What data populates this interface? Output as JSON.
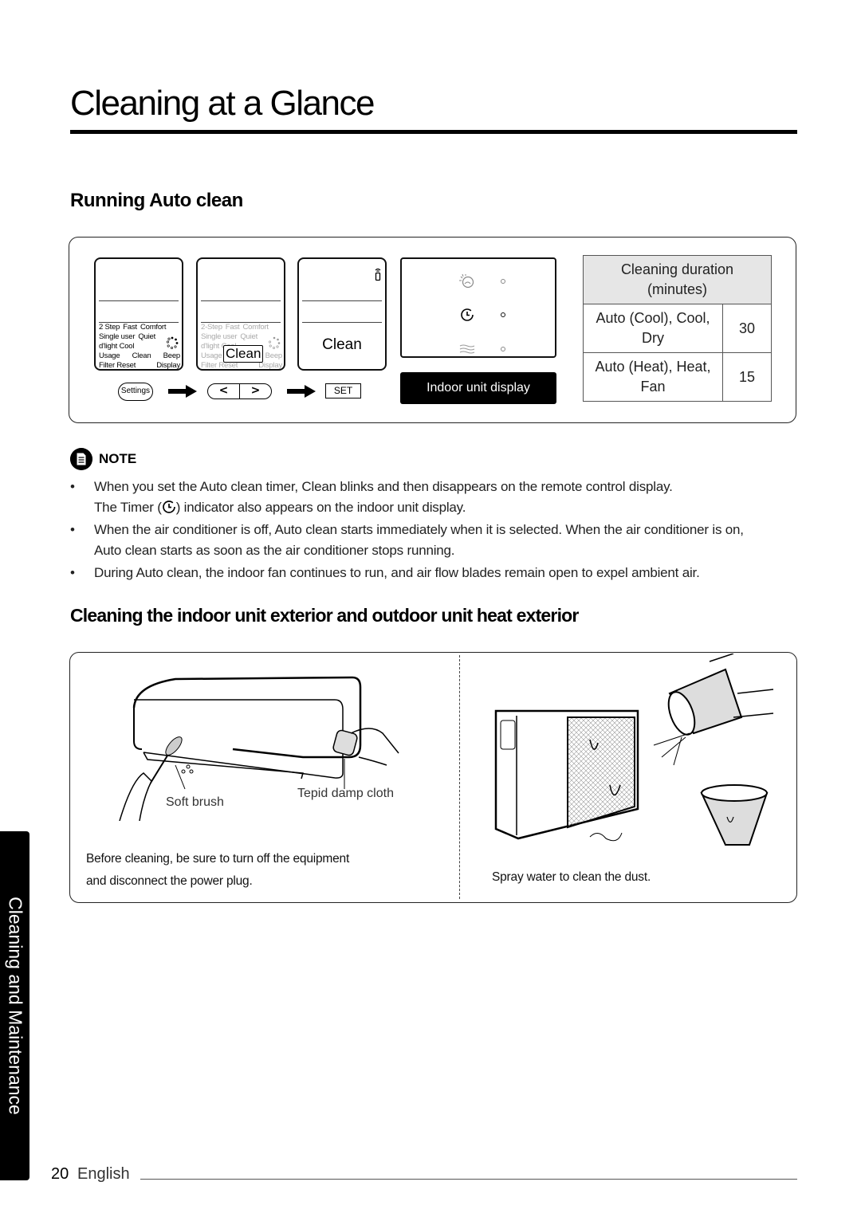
{
  "page": {
    "title": "Cleaning at a Glance",
    "side_tab": "Cleaning and Maintenance",
    "page_number": "20",
    "language": "English"
  },
  "auto_clean": {
    "heading": "Running Auto clean",
    "remote_screen_1": {
      "menu_rows": [
        [
          "2 Step",
          "Fast",
          "Comfort"
        ],
        [
          "Single user",
          "Quiet"
        ],
        [
          "d'light Cool"
        ],
        [
          "Usage",
          "Clean",
          "Beep"
        ],
        [
          "Filter Reset",
          "Display"
        ]
      ]
    },
    "remote_screen_2": {
      "menu_rows": [
        [
          "2-Step",
          "Fast",
          "Comfort"
        ],
        [
          "Single user",
          "Quiet"
        ],
        [
          "d'light Cool"
        ],
        [
          "Usage",
          "Clean",
          "Beep"
        ],
        [
          "Filter Reset",
          "Display"
        ]
      ],
      "highlight": "Clean"
    },
    "remote_screen_3": {
      "label": "Clean",
      "icon": "remote-signal-icon"
    },
    "buttons": {
      "settings": "Settings",
      "left": "<",
      "right": ">",
      "set": "SET"
    },
    "indoor_display": {
      "label": "Indoor unit display",
      "indicators": [
        {
          "icon": "auto-clean-icon",
          "state": "off"
        },
        {
          "icon": "timer-icon",
          "state": "on"
        },
        {
          "icon": "wind-icon",
          "state": "off"
        }
      ]
    },
    "duration_table": {
      "header": "Cleaning duration\n(minutes)",
      "header_line1": "Cleaning duration",
      "header_line2": "(minutes)",
      "rows": [
        {
          "mode_line1": "Auto (Cool), Cool,",
          "mode_line2": "Dry",
          "minutes": "30"
        },
        {
          "mode_line1": "Auto (Heat), Heat,",
          "mode_line2": "Fan",
          "minutes": "15"
        }
      ]
    }
  },
  "note": {
    "label": "NOTE",
    "bullets": [
      {
        "line1": "When you set the Auto clean timer, Clean blinks and then disappears on the remote control display.",
        "line2_before": "The Timer (",
        "line2_after": ") indicator also appears on the indoor unit display."
      },
      {
        "line1": "When the air conditioner is off, Auto clean starts immediately when it is selected. When the air conditioner is on,",
        "line2": "Auto clean starts as soon as the air conditioner stops running."
      },
      {
        "line1": "During Auto clean, the indoor fan continues to run, and air flow blades remain open to expel ambient air."
      }
    ]
  },
  "exterior": {
    "heading": "Cleaning the indoor unit exterior and outdoor unit heat exterior",
    "indoor_panel": {
      "callout_brush": "Soft brush",
      "callout_cloth": "Tepid damp cloth",
      "caption_line1": "Before cleaning, be sure to turn off the equipment",
      "caption_line2": "and disconnect the power plug."
    },
    "outdoor_panel": {
      "caption": "Spray water to clean the dust."
    }
  }
}
